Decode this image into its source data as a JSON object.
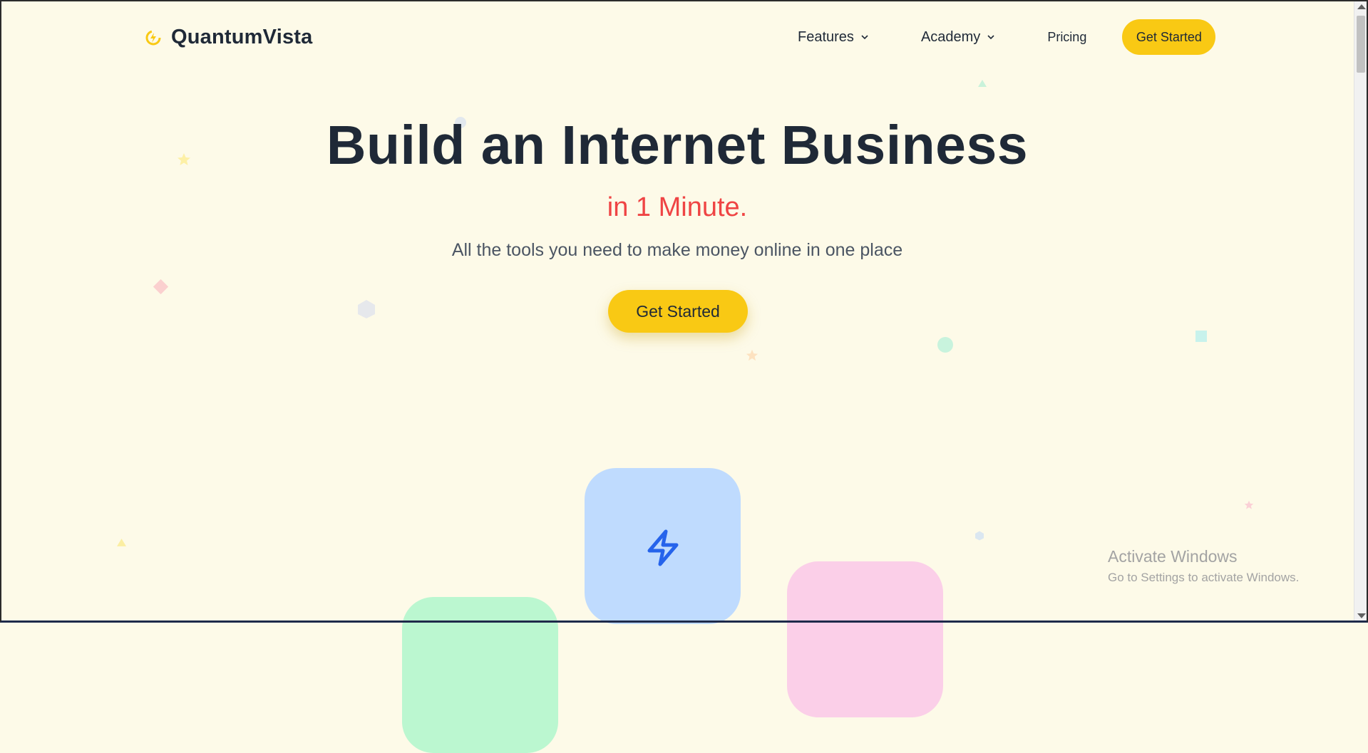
{
  "brand": {
    "name": "QuantumVista",
    "accent": "#f9c914"
  },
  "nav": {
    "links": [
      {
        "label": "Features",
        "has_dropdown": true
      },
      {
        "label": "Academy",
        "has_dropdown": true
      },
      {
        "label": "Pricing",
        "has_dropdown": false
      }
    ],
    "cta_label": "Get Started"
  },
  "hero": {
    "title": "Build an Internet Business",
    "subtitle": "in 1 Minute.",
    "description": "All the tools you need to make money online in one place",
    "cta_label": "Get Started"
  },
  "cards": [
    {
      "color": "#bfdbfe",
      "icon": "lightning-bolt-icon"
    },
    {
      "color": "#fbcfe8",
      "icon": ""
    },
    {
      "color": "#bbf7d0",
      "icon": ""
    }
  ],
  "os_watermark": {
    "title": "Activate Windows",
    "subtitle": "Go to Settings to activate Windows."
  }
}
